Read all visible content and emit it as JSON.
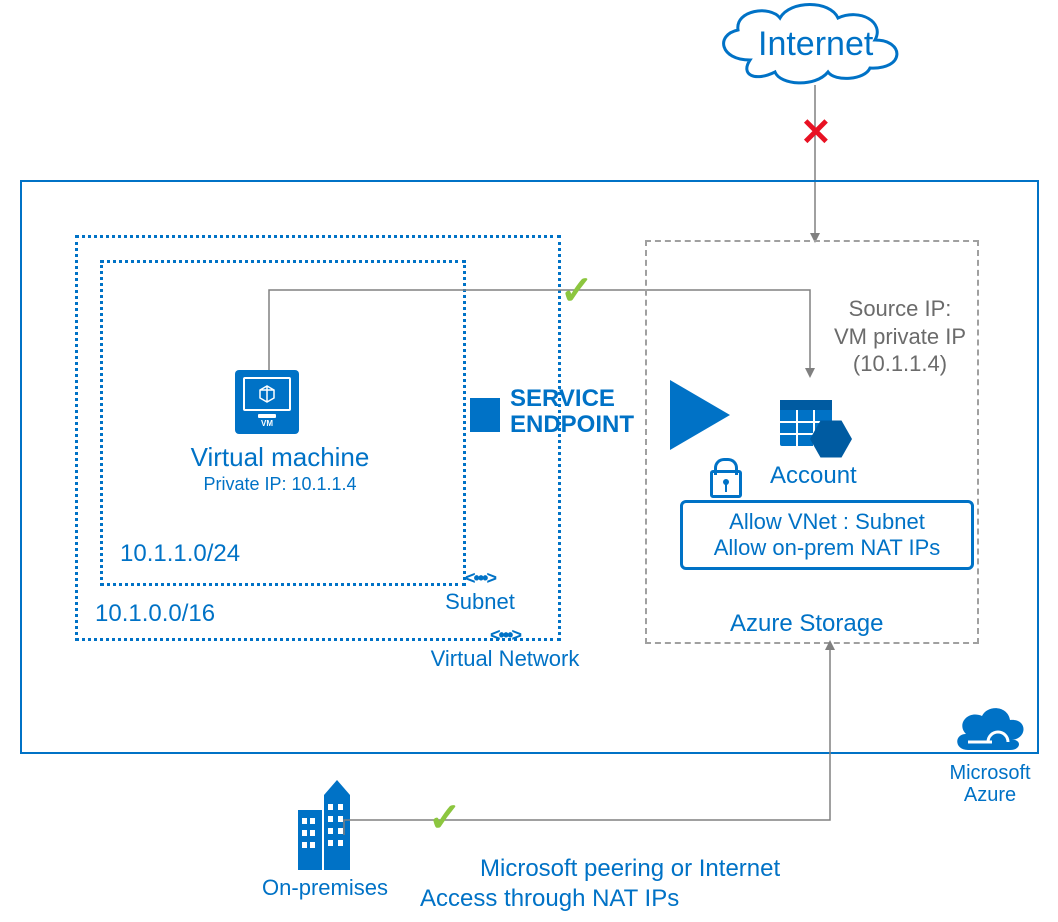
{
  "internet_label": "Internet",
  "azure_region": {
    "vnet_cidr": "10.1.0.0/16",
    "subnet_cidr": "10.1.1.0/24",
    "subnet_label": "Subnet",
    "vnet_label": "Virtual Network",
    "vm": {
      "title": "Virtual machine",
      "private_ip_label": "Private IP: 10.1.1.4"
    },
    "service_endpoint_line1": "SERVICE",
    "service_endpoint_line2": "ENDPOINT"
  },
  "storage": {
    "container_label": "Azure Storage",
    "source_ip_line1": "Source IP:",
    "source_ip_line2": "VM private IP",
    "source_ip_line3": "(10.1.1.4)",
    "account_label": "Account",
    "rule_line1": "Allow VNet : Subnet",
    "rule_line2": "Allow on-prem NAT IPs"
  },
  "onprem": {
    "label": "On-premises",
    "peering_line1": "Microsoft peering or Internet",
    "peering_line2": "Access through NAT IPs"
  },
  "azure_brand_line1": "Microsoft",
  "azure_brand_line2": "Azure",
  "marks": {
    "internet_blocked": "✕",
    "vm_allowed": "✓",
    "onprem_allowed": "✓"
  }
}
